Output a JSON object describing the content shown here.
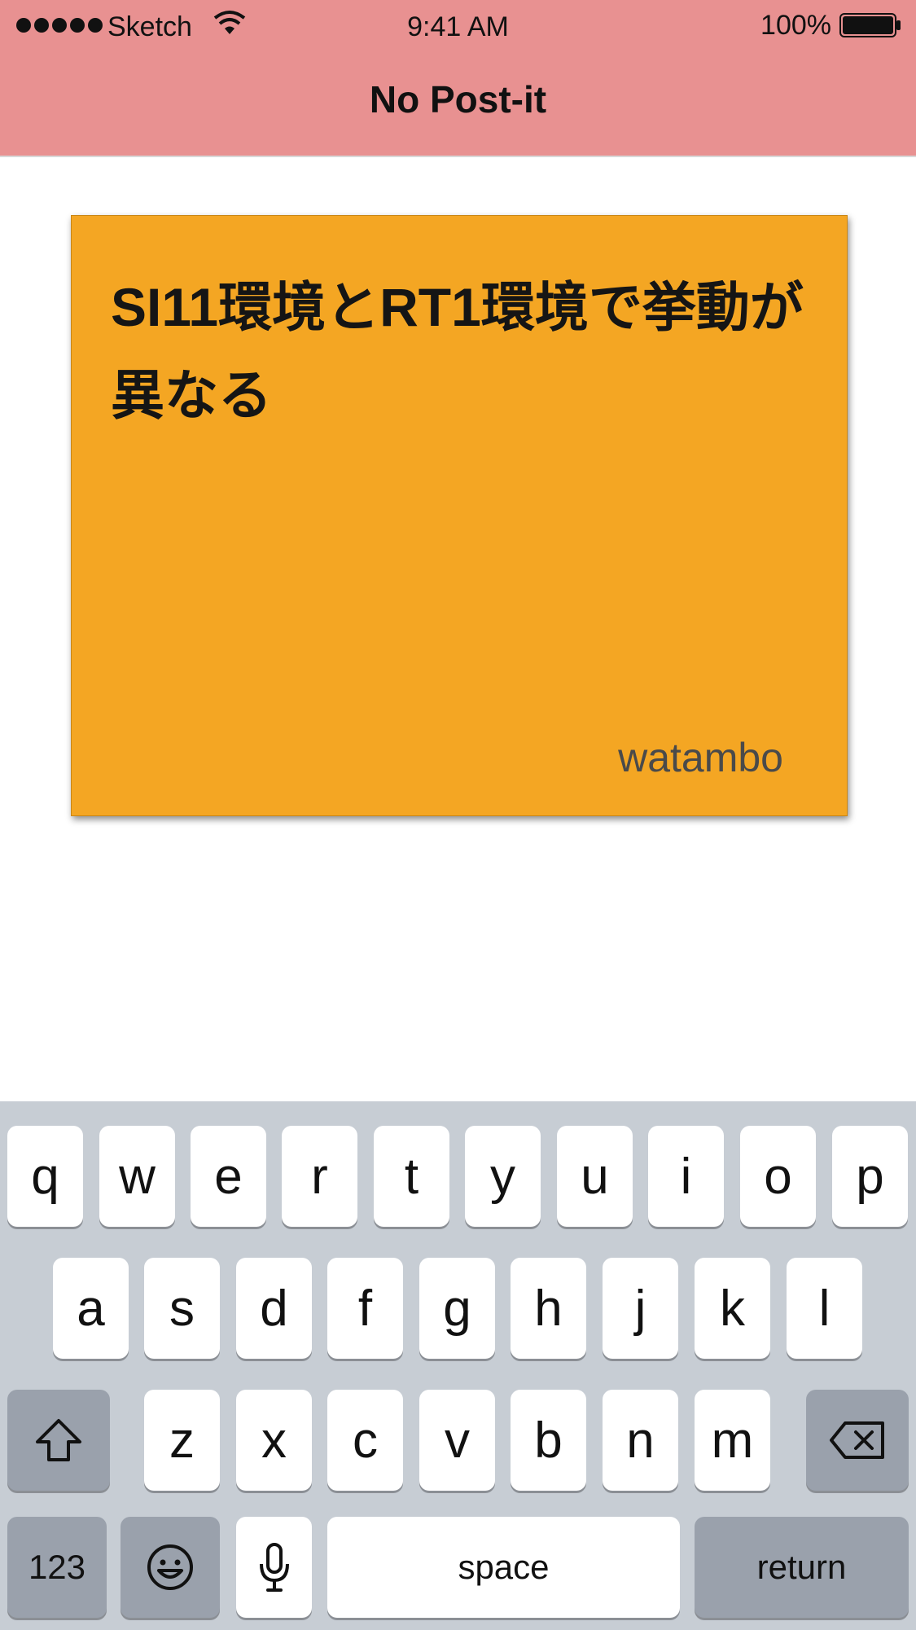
{
  "status_bar": {
    "carrier": "Sketch",
    "time": "9:41 AM",
    "battery_percent": "100%",
    "signal_icon": "signal-dots-icon",
    "wifi_icon": "wifi-icon",
    "battery_icon": "battery-full-icon"
  },
  "nav": {
    "title": "No Post-it"
  },
  "postit": {
    "text": "SI11環境とRT1環境で挙動が異なる",
    "author": "watambo",
    "color": "#f4a623"
  },
  "header_color": "#e89191",
  "keyboard": {
    "row1": [
      "q",
      "w",
      "e",
      "r",
      "t",
      "y",
      "u",
      "i",
      "o",
      "p"
    ],
    "row2": [
      "a",
      "s",
      "d",
      "f",
      "g",
      "h",
      "j",
      "k",
      "l"
    ],
    "row3": [
      "z",
      "x",
      "c",
      "v",
      "b",
      "n",
      "m"
    ],
    "numbers_label": "123",
    "space_label": "space",
    "return_label": "return",
    "shift_icon": "shift-icon",
    "delete_icon": "delete-icon",
    "emoji_icon": "emoji-icon",
    "mic_icon": "microphone-icon"
  }
}
